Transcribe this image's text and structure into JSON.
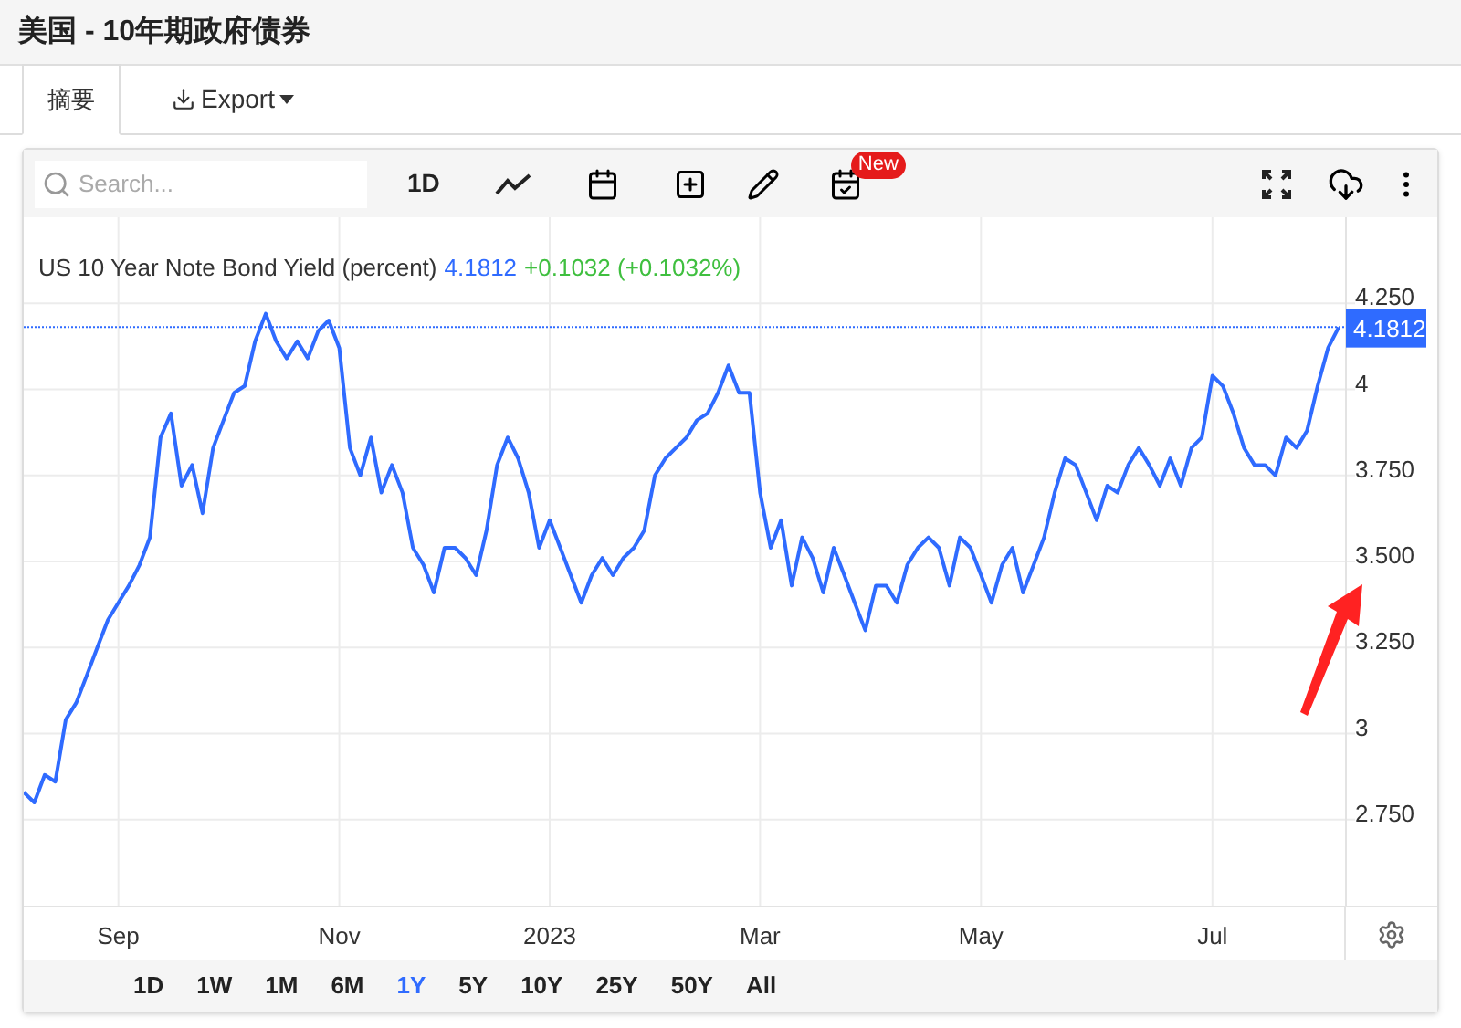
{
  "title": "美国 - 10年期政府债券",
  "tabs": [
    {
      "label": "摘要",
      "selected": true
    }
  ],
  "export": {
    "label": "Export"
  },
  "toolbar": {
    "search": {
      "placeholder": "Search..."
    },
    "interval": "1D",
    "badge": "New"
  },
  "legend": {
    "last": "4.1812",
    "change": "+0.1032 (+0.1032%)"
  },
  "chart": {
    "last_label": "4.1812",
    "chart_data": {
      "type": "line",
      "grid": true,
      "ref_lines": [
        {
          "axis": "y",
          "value": 4.1812,
          "color": "#2f6bff"
        }
      ],
      "ylim": [
        2.5,
        4.5
      ],
      "categories": [
        null,
        null,
        null,
        null,
        null,
        null,
        null,
        null,
        null,
        "Sep",
        null,
        null,
        null,
        null,
        null,
        null,
        null,
        null,
        null,
        null,
        null,
        null,
        null,
        null,
        null,
        null,
        null,
        null,
        null,
        null,
        "Nov",
        null,
        null,
        null,
        null,
        null,
        null,
        null,
        null,
        null,
        null,
        null,
        null,
        null,
        null,
        null,
        null,
        null,
        null,
        null,
        "2023",
        null,
        null,
        null,
        null,
        null,
        null,
        null,
        null,
        null,
        null,
        null,
        null,
        null,
        null,
        null,
        null,
        null,
        null,
        null,
        "Mar",
        null,
        null,
        null,
        null,
        null,
        null,
        null,
        null,
        null,
        null,
        null,
        null,
        null,
        null,
        null,
        null,
        null,
        null,
        null,
        null,
        "May",
        null,
        null,
        null,
        null,
        null,
        null,
        null,
        null,
        null,
        null,
        null,
        null,
        null,
        null,
        null,
        null,
        null,
        null,
        null,
        null,
        null,
        "Jul",
        null,
        null,
        null,
        null,
        null,
        null,
        null,
        null,
        null,
        null,
        null,
        null
      ],
      "yticks": [
        {
          "value": 4.25,
          "label": "4.250"
        },
        {
          "value": 4,
          "label": "4"
        },
        {
          "value": 3.75,
          "label": "3.750"
        },
        {
          "value": 3.5,
          "label": "3.500"
        },
        {
          "value": 3.25,
          "label": "3.250"
        },
        {
          "value": 3,
          "label": "3"
        },
        {
          "value": 2.75,
          "label": "2.750"
        }
      ],
      "series": [
        {
          "name": "US 10 Year Note Bond Yield (percent)",
          "color": "#2f6bff",
          "values": [
            2.83,
            2.8,
            2.88,
            2.86,
            3.04,
            3.09,
            3.17,
            3.25,
            3.33,
            3.38,
            3.43,
            3.49,
            3.57,
            3.86,
            3.93,
            3.72,
            3.78,
            3.64,
            3.83,
            3.91,
            3.99,
            4.01,
            4.14,
            4.22,
            4.14,
            4.09,
            4.14,
            4.09,
            4.17,
            4.2,
            4.12,
            3.83,
            3.75,
            3.86,
            3.7,
            3.78,
            3.7,
            3.54,
            3.49,
            3.41,
            3.54,
            3.54,
            3.51,
            3.46,
            3.59,
            3.78,
            3.86,
            3.8,
            3.7,
            3.54,
            3.62,
            3.54,
            3.46,
            3.38,
            3.46,
            3.51,
            3.46,
            3.51,
            3.54,
            3.59,
            3.75,
            3.8,
            3.83,
            3.86,
            3.91,
            3.93,
            3.99,
            4.07,
            3.99,
            3.99,
            3.7,
            3.54,
            3.62,
            3.43,
            3.57,
            3.51,
            3.41,
            3.54,
            3.46,
            3.38,
            3.3,
            3.43,
            3.43,
            3.38,
            3.49,
            3.54,
            3.57,
            3.54,
            3.43,
            3.57,
            3.54,
            3.46,
            3.38,
            3.49,
            3.54,
            3.41,
            3.49,
            3.57,
            3.7,
            3.8,
            3.78,
            3.7,
            3.62,
            3.72,
            3.7,
            3.78,
            3.83,
            3.78,
            3.72,
            3.8,
            3.72,
            3.83,
            3.86,
            4.04,
            4.01,
            3.93,
            3.83,
            3.78,
            3.78,
            3.75,
            3.86,
            3.83,
            3.88,
            4.01,
            4.12,
            4.18
          ]
        }
      ]
    }
  },
  "ranges": [
    {
      "label": "1D",
      "selected": false
    },
    {
      "label": "1W",
      "selected": false
    },
    {
      "label": "1M",
      "selected": false
    },
    {
      "label": "6M",
      "selected": false
    },
    {
      "label": "1Y",
      "selected": true
    },
    {
      "label": "5Y",
      "selected": false
    },
    {
      "label": "10Y",
      "selected": false
    },
    {
      "label": "25Y",
      "selected": false
    },
    {
      "label": "50Y",
      "selected": false
    },
    {
      "label": "All",
      "selected": false
    }
  ]
}
